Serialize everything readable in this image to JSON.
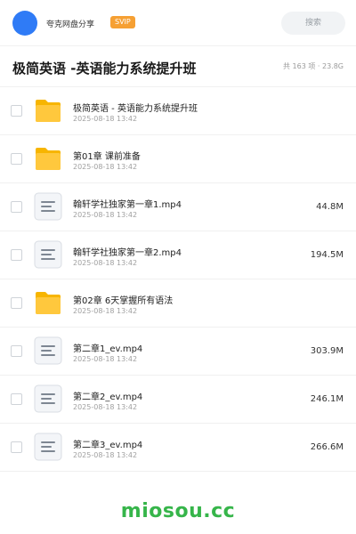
{
  "header": {
    "share_name": "夸克网盘分享",
    "badge": "SVIP",
    "search_placeholder": "搜索"
  },
  "title": {
    "text": "极简英语 -英语能力系统提升班",
    "meta": "共 163 项 · 23.8G"
  },
  "files": [
    {
      "type": "folder",
      "name": "极简英语 - 英语能力系统提升班",
      "date": "2025-08-18 13:42",
      "size": ""
    },
    {
      "type": "folder",
      "name": "第01章 课前准备",
      "date": "2025-08-18 13:42",
      "size": ""
    },
    {
      "type": "file",
      "name": "翰轩学社独家第一章1.mp4",
      "date": "2025-08-18 13:42",
      "size": "44.8M"
    },
    {
      "type": "file",
      "name": "翰轩学社独家第一章2.mp4",
      "date": "2025-08-18 13:42",
      "size": "194.5M"
    },
    {
      "type": "folder",
      "name": "第02章 6天掌握所有语法",
      "date": "2025-08-18 13:42",
      "size": ""
    },
    {
      "type": "file",
      "name": "第二章1_ev.mp4",
      "date": "2025-08-18 13:42",
      "size": "303.9M"
    },
    {
      "type": "file",
      "name": "第二章2_ev.mp4",
      "date": "2025-08-18 13:42",
      "size": "246.1M"
    },
    {
      "type": "file",
      "name": "第二章3_ev.mp4",
      "date": "2025-08-18 13:42",
      "size": "266.6M"
    }
  ],
  "footer": {
    "watermark": "miosou.cc"
  },
  "colors": {
    "avatar": "#2f7bf6",
    "svip_badge": "#f6a033",
    "folder": "#ffc107",
    "watermark": "#36b54a"
  }
}
